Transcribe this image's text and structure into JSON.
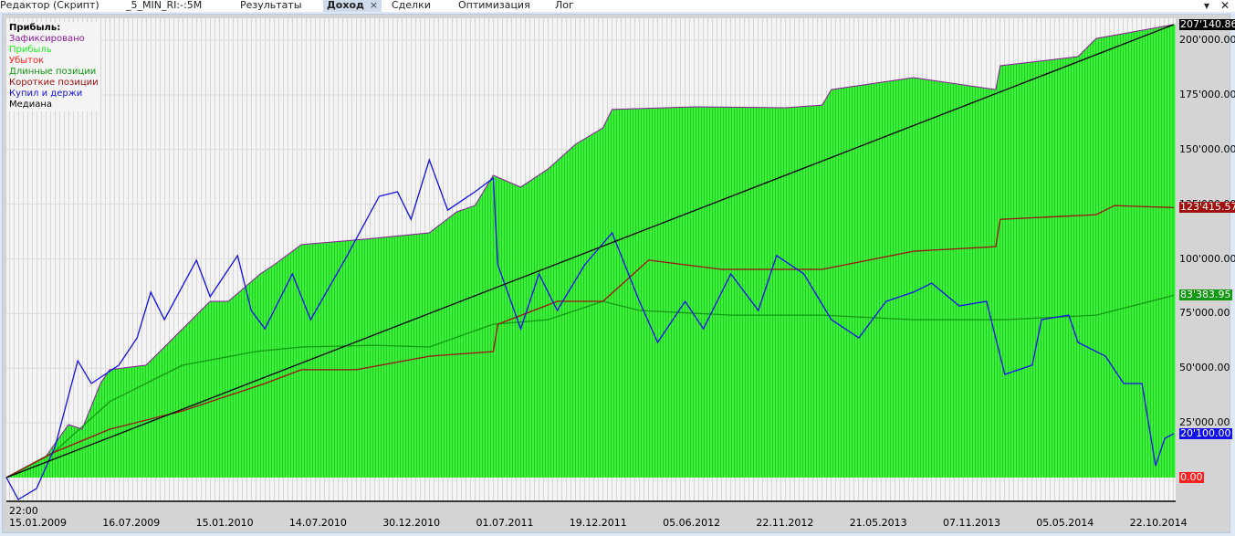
{
  "tabs": [
    {
      "label": "Редактор (Скрипт)"
    },
    {
      "label": "_5_MIN_RI:-:5M"
    },
    {
      "label": "Результаты"
    },
    {
      "label": "Доход",
      "active": true
    },
    {
      "label": "Сделки"
    },
    {
      "label": "Оптимизация"
    },
    {
      "label": "Лог"
    }
  ],
  "icons": {
    "tab_close": "×",
    "dropdown": "▾",
    "window_close": "✕"
  },
  "legend": {
    "title": "Прибыль:",
    "items": [
      {
        "label": "Зафиксировано",
        "color": "#8a1a9a"
      },
      {
        "label": "Прибыль",
        "color": "#22ee22"
      },
      {
        "label": "Убыток",
        "color": "#ff2020"
      },
      {
        "label": "Длинные позиции",
        "color": "#119911"
      },
      {
        "label": "Короткие позиции",
        "color": "#a01010"
      },
      {
        "label": "Купил и держи",
        "color": "#1010ee"
      },
      {
        "label": "Медиана",
        "color": "#000000"
      }
    ]
  },
  "chart_data": {
    "type": "area",
    "x_unit": "months since 15.01.2009",
    "xlim": [
      0,
      71
    ],
    "ylim": [
      -12000,
      212000
    ],
    "y_ticks": [
      "200'000.00",
      "175'000.00",
      "150'000.00",
      "125'000.00",
      "100'000.00",
      "75'000.00",
      "50'000.00",
      "25'000.00"
    ],
    "y_tick_values": [
      200000,
      175000,
      150000,
      125000,
      100000,
      75000,
      50000,
      25000
    ],
    "x_time_label": "22:00",
    "x_ticks": [
      "15.01.2009",
      "16.07.2009",
      "15.01.2010",
      "14.07.2010",
      "30.12.2010",
      "01.07.2011",
      "19.12.2011",
      "05.06.2012",
      "22.11.2012",
      "21.05.2013",
      "07.11.2013",
      "05.05.2014",
      "22.10.2014"
    ],
    "badges": [
      {
        "text": "207'140.86",
        "value": 207140.86,
        "bg": "#000000",
        "fg": "#ffffff"
      },
      {
        "text": "123'415.57",
        "value": 123415.57,
        "bg": "#a01010",
        "fg": "#ffffff"
      },
      {
        "text": "83'383.95",
        "value": 83383.95,
        "bg": "#119911",
        "fg": "#ffffff"
      },
      {
        "text": "20'100.00",
        "value": 20100,
        "bg": "#1010ee",
        "fg": "#ffffff"
      },
      {
        "text": "0.00",
        "value": 0,
        "bg": "#ff2020",
        "fg": "#ffffff"
      }
    ],
    "series": [
      {
        "name": "Прибыль",
        "kind": "area",
        "color": "#33ee33",
        "points": [
          [
            0,
            0
          ],
          [
            2.39,
            9600
          ],
          [
            3.78,
            24200
          ],
          [
            4.61,
            22100
          ],
          [
            5.72,
            43000
          ],
          [
            6.28,
            49300
          ],
          [
            8.5,
            51400
          ],
          [
            9.61,
            59700
          ],
          [
            12.39,
            80600
          ],
          [
            13.5,
            80600
          ],
          [
            15.44,
            93100
          ],
          [
            16.28,
            97300
          ],
          [
            17.94,
            106500
          ],
          [
            21.83,
            109000
          ],
          [
            25.72,
            111900
          ],
          [
            27.39,
            121500
          ],
          [
            28.5,
            124400
          ],
          [
            29.61,
            138200
          ],
          [
            31.28,
            132800
          ],
          [
            32.94,
            141100
          ],
          [
            34.61,
            152400
          ],
          [
            36.28,
            159900
          ],
          [
            36.83,
            168300
          ],
          [
            41.83,
            169500
          ],
          [
            47.39,
            169100
          ],
          [
            49.61,
            170300
          ],
          [
            50.17,
            177400
          ],
          [
            55.17,
            182900
          ],
          [
            60.17,
            177400
          ],
          [
            60.44,
            188300
          ],
          [
            65.17,
            192500
          ],
          [
            66.28,
            200800
          ],
          [
            71,
            207140.86
          ]
        ]
      },
      {
        "name": "Длинные позиции",
        "kind": "line",
        "color": "#119911",
        "points": [
          [
            0,
            0
          ],
          [
            2.95,
            12000
          ],
          [
            6.28,
            34700
          ],
          [
            10.72,
            51400
          ],
          [
            15.17,
            57600
          ],
          [
            17.94,
            59700
          ],
          [
            22.39,
            60500
          ],
          [
            25.72,
            59700
          ],
          [
            29.61,
            70100
          ],
          [
            32.94,
            72200
          ],
          [
            36.28,
            80600
          ],
          [
            38.5,
            76400
          ],
          [
            44.06,
            74300
          ],
          [
            49.61,
            74300
          ],
          [
            55.17,
            72200
          ],
          [
            60.72,
            72200
          ],
          [
            66.28,
            74300
          ],
          [
            70.7,
            82700
          ],
          [
            71,
            83383.95
          ]
        ]
      },
      {
        "name": "Короткие позиции",
        "kind": "line",
        "color": "#a01010",
        "points": [
          [
            0,
            0
          ],
          [
            2.95,
            11700
          ],
          [
            6.28,
            22100
          ],
          [
            10.72,
            30500
          ],
          [
            15.72,
            43000
          ],
          [
            17.94,
            49300
          ],
          [
            21.28,
            49300
          ],
          [
            25.72,
            55500
          ],
          [
            29.61,
            57600
          ],
          [
            29.89,
            70100
          ],
          [
            33.5,
            80600
          ],
          [
            36.28,
            80600
          ],
          [
            39.06,
            99400
          ],
          [
            43.5,
            95200
          ],
          [
            49.61,
            95200
          ],
          [
            55.17,
            103500
          ],
          [
            60.17,
            105600
          ],
          [
            60.44,
            118100
          ],
          [
            66.28,
            120200
          ],
          [
            67.39,
            124400
          ],
          [
            71,
            123415.57
          ]
        ]
      },
      {
        "name": "Купил и держи",
        "kind": "line",
        "color": "#1010ee",
        "points": [
          [
            0,
            0
          ],
          [
            0.72,
            -10000
          ],
          [
            1.83,
            -5000
          ],
          [
            2.95,
            13800
          ],
          [
            4.34,
            53400
          ],
          [
            5.17,
            43000
          ],
          [
            6.84,
            51400
          ],
          [
            7.95,
            63900
          ],
          [
            8.78,
            84800
          ],
          [
            9.61,
            72200
          ],
          [
            11.56,
            99400
          ],
          [
            12.39,
            82700
          ],
          [
            14.06,
            101500
          ],
          [
            14.89,
            76400
          ],
          [
            15.72,
            68000
          ],
          [
            17.39,
            93100
          ],
          [
            18.5,
            72200
          ],
          [
            20.73,
            101500
          ],
          [
            22.67,
            128600
          ],
          [
            23.78,
            130700
          ],
          [
            24.61,
            118100
          ],
          [
            25.72,
            145300
          ],
          [
            26.84,
            122300
          ],
          [
            28.5,
            130700
          ],
          [
            29.61,
            136900
          ],
          [
            29.89,
            97300
          ],
          [
            31.28,
            68000
          ],
          [
            32.39,
            93100
          ],
          [
            33.5,
            76400
          ],
          [
            35.17,
            97300
          ],
          [
            36.84,
            111900
          ],
          [
            38.5,
            80600
          ],
          [
            39.61,
            61800
          ],
          [
            41.28,
            80600
          ],
          [
            42.39,
            68000
          ],
          [
            44.06,
            93100
          ],
          [
            45.73,
            76400
          ],
          [
            46.84,
            101500
          ],
          [
            48.5,
            93100
          ],
          [
            50.17,
            72200
          ],
          [
            51.84,
            63900
          ],
          [
            53.5,
            80600
          ],
          [
            55.17,
            84800
          ],
          [
            56.28,
            88900
          ],
          [
            57.95,
            78500
          ],
          [
            59.61,
            80600
          ],
          [
            60.72,
            47200
          ],
          [
            62.39,
            51400
          ],
          [
            62.95,
            72200
          ],
          [
            64.61,
            74300
          ],
          [
            65.17,
            61800
          ],
          [
            66.84,
            55500
          ],
          [
            67.95,
            43000
          ],
          [
            69.06,
            43000
          ],
          [
            69.89,
            5400
          ],
          [
            70.45,
            17900
          ],
          [
            71,
            20100
          ]
        ]
      },
      {
        "name": "Медиана",
        "kind": "line",
        "color": "#000000",
        "points": [
          [
            0,
            0
          ],
          [
            71,
            207140.86
          ]
        ]
      }
    ]
  }
}
